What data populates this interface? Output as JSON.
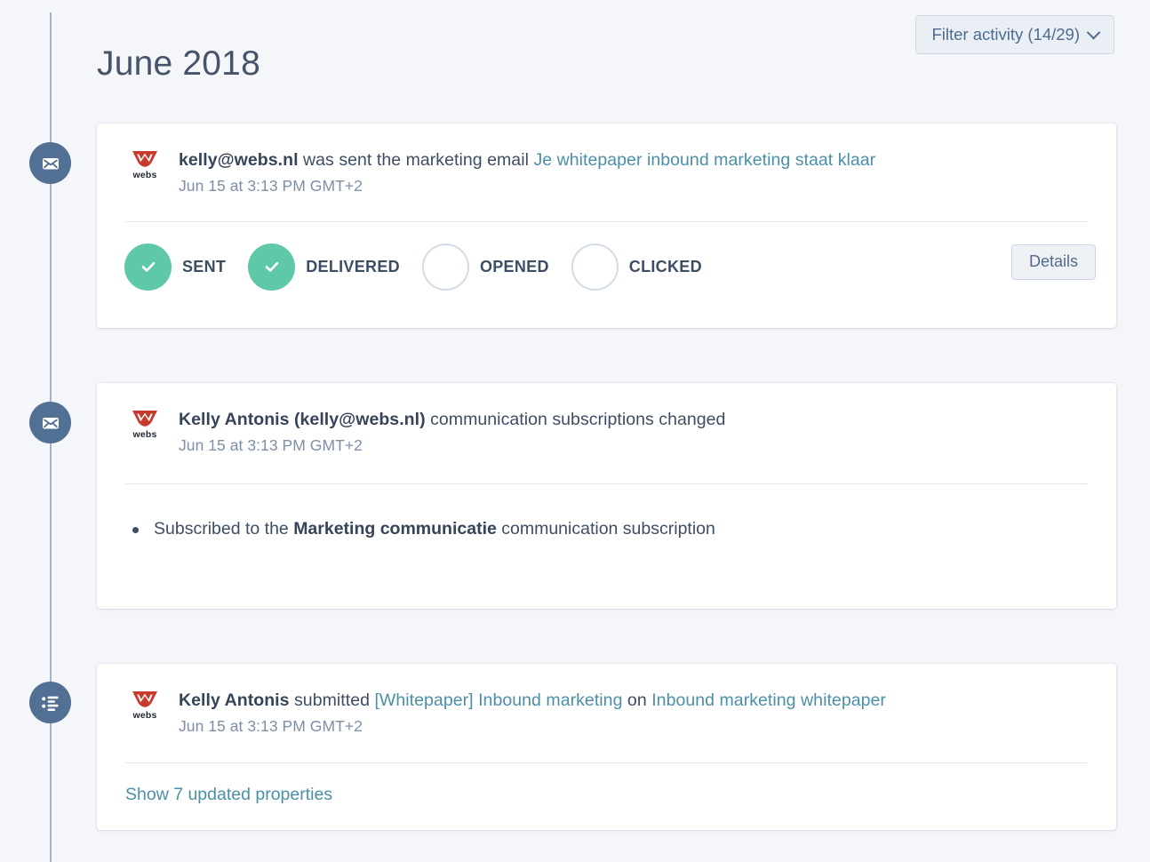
{
  "header": {
    "title": "June 2018",
    "filter_button": {
      "label": "Filter activity (14/29)",
      "icon": "chevron-down-icon"
    }
  },
  "colors": {
    "page_background": "#f5f6f9",
    "card_background": "#ffffff",
    "timeline_node": "#526f94",
    "timeline_rail": "#a5b4cb",
    "link": "#4b8fa8",
    "text_primary": "#3d4d63",
    "text_muted": "#7e8fa8",
    "status_complete": "#5fc8a8",
    "status_incomplete_border": "#d3dbe6",
    "brand_logo": "#c8392e"
  },
  "brand": {
    "logo_icon": "webs-logo",
    "wordmark": "webs"
  },
  "events": [
    {
      "node_icon": "envelope-icon",
      "headline_parts": [
        {
          "text": "kelly@webs.nl",
          "style": "bold"
        },
        {
          "text": " was sent the marketing email ",
          "style": "normal"
        },
        {
          "text": "Je whitepaper inbound marketing staat klaar",
          "style": "link"
        }
      ],
      "timestamp": "Jun 15 at 3:13 PM GMT+2",
      "email_status": [
        {
          "label": "SENT",
          "complete": true
        },
        {
          "label": "DELIVERED",
          "complete": true
        },
        {
          "label": "OPENED",
          "complete": false
        },
        {
          "label": "CLICKED",
          "complete": false
        }
      ],
      "details_button": "Details"
    },
    {
      "node_icon": "envelope-icon",
      "headline_parts": [
        {
          "text": "Kelly Antonis (kelly@webs.nl)",
          "style": "bold"
        },
        {
          "text": " communication subscriptions changed",
          "style": "normal"
        }
      ],
      "timestamp": "Jun 15 at 3:13 PM GMT+2",
      "bullets": [
        [
          {
            "text": "Subscribed to the ",
            "style": "normal"
          },
          {
            "text": "Marketing communicatie",
            "style": "bold"
          },
          {
            "text": " communication subscription",
            "style": "normal"
          }
        ]
      ]
    },
    {
      "node_icon": "form-list-icon",
      "headline_parts": [
        {
          "text": "Kelly Antonis",
          "style": "bold"
        },
        {
          "text": " submitted ",
          "style": "normal"
        },
        {
          "text": "[Whitepaper] Inbound marketing",
          "style": "link"
        },
        {
          "text": " on ",
          "style": "normal"
        },
        {
          "text": "Inbound marketing whitepaper",
          "style": "link"
        }
      ],
      "timestamp": "Jun 15 at 3:13 PM GMT+2",
      "show_properties_link": "Show 7 updated properties"
    }
  ]
}
